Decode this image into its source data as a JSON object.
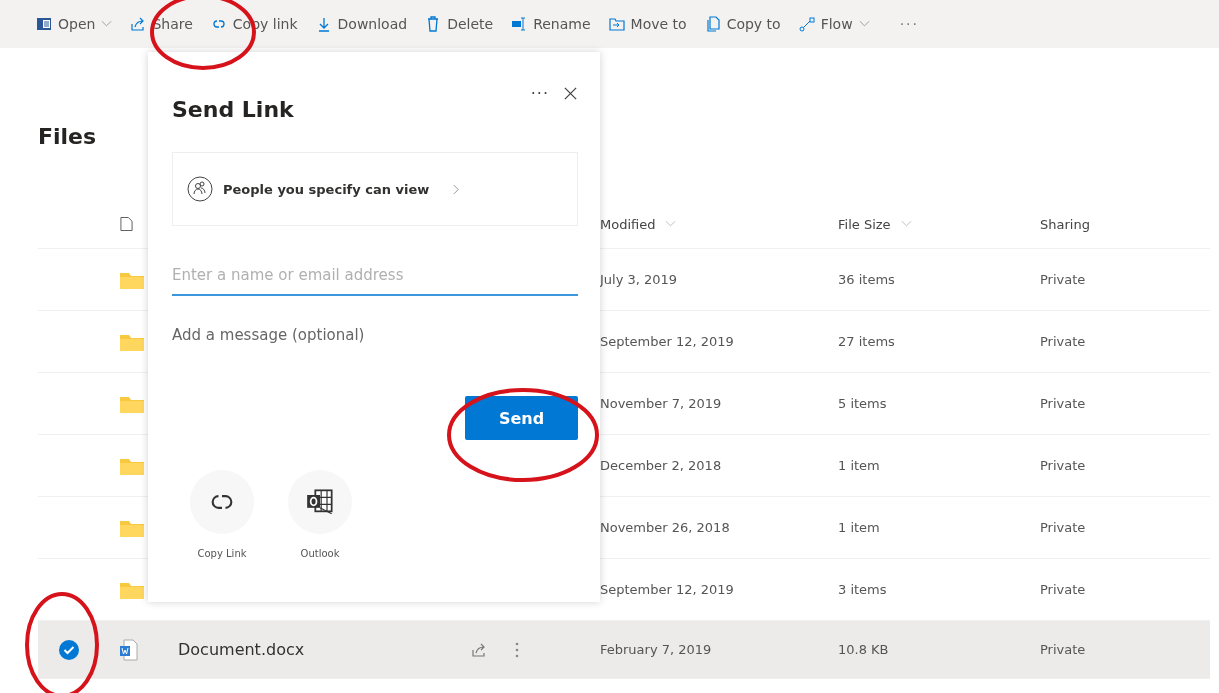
{
  "toolbar": {
    "items": [
      {
        "kind": "open",
        "label": "Open",
        "dropdown": true
      },
      {
        "kind": "share",
        "label": "Share",
        "dropdown": false
      },
      {
        "kind": "link",
        "label": "Copy link",
        "dropdown": false
      },
      {
        "kind": "download",
        "label": "Download",
        "dropdown": false
      },
      {
        "kind": "delete",
        "label": "Delete",
        "dropdown": false
      },
      {
        "kind": "rename",
        "label": "Rename",
        "dropdown": false
      },
      {
        "kind": "move",
        "label": "Move to",
        "dropdown": false
      },
      {
        "kind": "copy",
        "label": "Copy to",
        "dropdown": false
      },
      {
        "kind": "flow",
        "label": "Flow",
        "dropdown": true
      }
    ],
    "more": "···"
  },
  "page_title": "Files",
  "table": {
    "columns": [
      {
        "label": "Modified",
        "sortable": true
      },
      {
        "label": "File Size",
        "sortable": true
      },
      {
        "label": "Sharing",
        "sortable": false
      }
    ],
    "rows": [
      {
        "kind": "folder",
        "selected": false,
        "modified": "July 3, 2019",
        "size": "36 items",
        "sharing": "Private"
      },
      {
        "kind": "folder",
        "selected": false,
        "modified": "September 12, 2019",
        "size": "27 items",
        "sharing": "Private"
      },
      {
        "kind": "folder",
        "selected": false,
        "modified": "November 7, 2019",
        "size": "5 items",
        "sharing": "Private"
      },
      {
        "kind": "folder",
        "selected": false,
        "modified": "December 2, 2018",
        "size": "1 item",
        "sharing": "Private"
      },
      {
        "kind": "folder",
        "selected": false,
        "modified": "November 26, 2018",
        "size": "1 item",
        "sharing": "Private"
      },
      {
        "kind": "folder",
        "selected": false,
        "modified": "September 12, 2019",
        "size": "3 items",
        "sharing": "Private"
      },
      {
        "kind": "word",
        "selected": true,
        "name": "Document.docx",
        "modified": "February 7, 2019",
        "size": "10.8 KB",
        "sharing": "Private"
      }
    ]
  },
  "dialog": {
    "title": "Send Link",
    "more": "···",
    "permission": "People you specify can view",
    "recipient_placeholder": "Enter a name or email address",
    "message_placeholder": "Add a message (optional)",
    "send": "Send",
    "share_targets": [
      {
        "kind": "link",
        "label": "Copy Link"
      },
      {
        "kind": "outlook",
        "label": "Outlook"
      }
    ]
  }
}
